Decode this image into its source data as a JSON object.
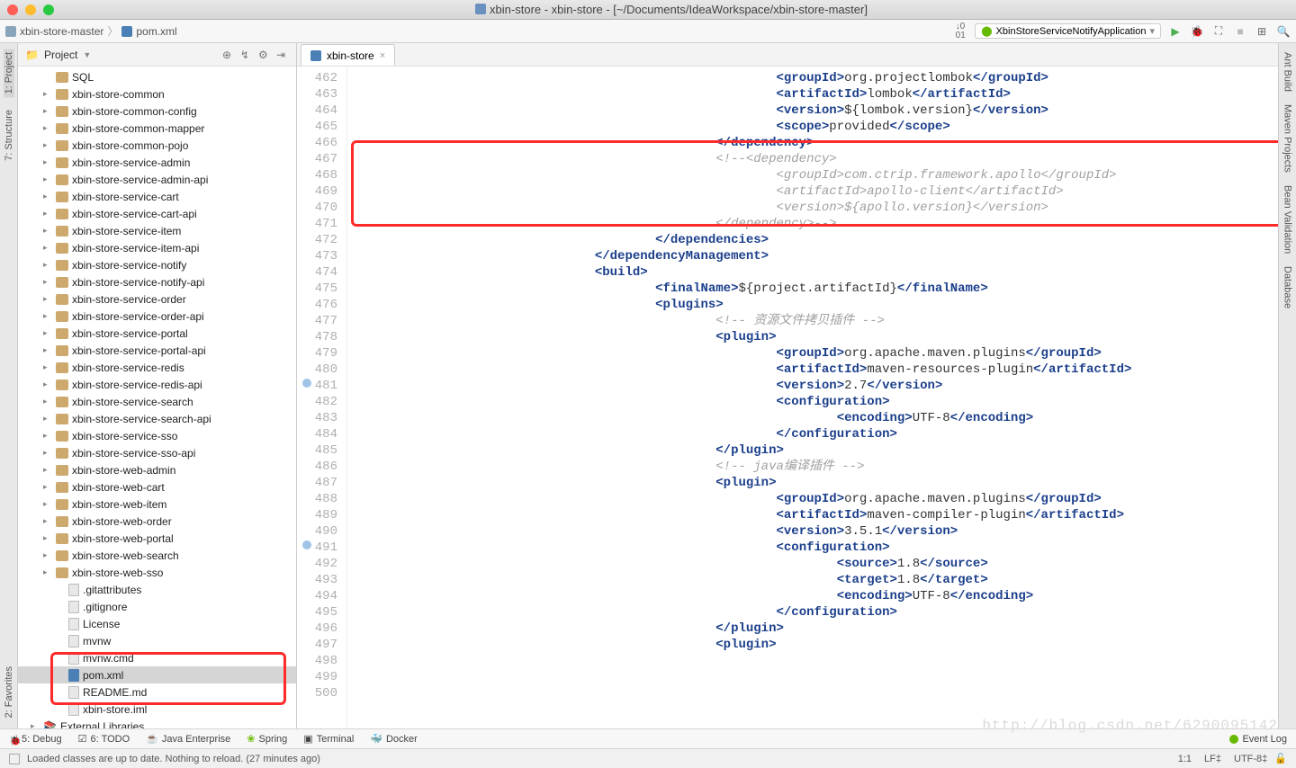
{
  "window": {
    "title": "xbin-store - xbin-store - [~/Documents/IdeaWorkspace/xbin-store-master]"
  },
  "breadcrumb": {
    "root": "xbin-store-master",
    "file": "pom.xml"
  },
  "runconfig": {
    "name": "XbinStoreServiceNotifyApplication"
  },
  "leftTabs": {
    "project": "1: Project",
    "structure": "7: Structure",
    "favorites": "2: Favorites"
  },
  "rightTabs": {
    "ant": "Ant Build",
    "maven": "Maven Projects",
    "bean": "Bean Validation",
    "db": "Database"
  },
  "projectPane": {
    "title": "Project"
  },
  "tree": [
    {
      "label": "SQL",
      "kind": "folder",
      "arrow": false,
      "indent": 28,
      "sql": true
    },
    {
      "label": "xbin-store-common",
      "kind": "folder",
      "arrow": true,
      "indent": 28
    },
    {
      "label": "xbin-store-common-config",
      "kind": "folder",
      "arrow": true,
      "indent": 28
    },
    {
      "label": "xbin-store-common-mapper",
      "kind": "folder",
      "arrow": true,
      "indent": 28
    },
    {
      "label": "xbin-store-common-pojo",
      "kind": "folder",
      "arrow": true,
      "indent": 28
    },
    {
      "label": "xbin-store-service-admin",
      "kind": "folder",
      "arrow": true,
      "indent": 28
    },
    {
      "label": "xbin-store-service-admin-api",
      "kind": "folder",
      "arrow": true,
      "indent": 28
    },
    {
      "label": "xbin-store-service-cart",
      "kind": "folder",
      "arrow": true,
      "indent": 28
    },
    {
      "label": "xbin-store-service-cart-api",
      "kind": "folder",
      "arrow": true,
      "indent": 28
    },
    {
      "label": "xbin-store-service-item",
      "kind": "folder",
      "arrow": true,
      "indent": 28
    },
    {
      "label": "xbin-store-service-item-api",
      "kind": "folder",
      "arrow": true,
      "indent": 28
    },
    {
      "label": "xbin-store-service-notify",
      "kind": "folder",
      "arrow": true,
      "indent": 28
    },
    {
      "label": "xbin-store-service-notify-api",
      "kind": "folder",
      "arrow": true,
      "indent": 28
    },
    {
      "label": "xbin-store-service-order",
      "kind": "folder",
      "arrow": true,
      "indent": 28
    },
    {
      "label": "xbin-store-service-order-api",
      "kind": "folder",
      "arrow": true,
      "indent": 28
    },
    {
      "label": "xbin-store-service-portal",
      "kind": "folder",
      "arrow": true,
      "indent": 28
    },
    {
      "label": "xbin-store-service-portal-api",
      "kind": "folder",
      "arrow": true,
      "indent": 28
    },
    {
      "label": "xbin-store-service-redis",
      "kind": "folder",
      "arrow": true,
      "indent": 28
    },
    {
      "label": "xbin-store-service-redis-api",
      "kind": "folder",
      "arrow": true,
      "indent": 28
    },
    {
      "label": "xbin-store-service-search",
      "kind": "folder",
      "arrow": true,
      "indent": 28
    },
    {
      "label": "xbin-store-service-search-api",
      "kind": "folder",
      "arrow": true,
      "indent": 28
    },
    {
      "label": "xbin-store-service-sso",
      "kind": "folder",
      "arrow": true,
      "indent": 28
    },
    {
      "label": "xbin-store-service-sso-api",
      "kind": "folder",
      "arrow": true,
      "indent": 28
    },
    {
      "label": "xbin-store-web-admin",
      "kind": "folder",
      "arrow": true,
      "indent": 28
    },
    {
      "label": "xbin-store-web-cart",
      "kind": "folder",
      "arrow": true,
      "indent": 28
    },
    {
      "label": "xbin-store-web-item",
      "kind": "folder",
      "arrow": true,
      "indent": 28
    },
    {
      "label": "xbin-store-web-order",
      "kind": "folder",
      "arrow": true,
      "indent": 28
    },
    {
      "label": "xbin-store-web-portal",
      "kind": "folder",
      "arrow": true,
      "indent": 28
    },
    {
      "label": "xbin-store-web-search",
      "kind": "folder",
      "arrow": true,
      "indent": 28
    },
    {
      "label": "xbin-store-web-sso",
      "kind": "folder",
      "arrow": true,
      "indent": 28
    },
    {
      "label": ".gitattributes",
      "kind": "file",
      "arrow": false,
      "indent": 42
    },
    {
      "label": ".gitignore",
      "kind": "file",
      "arrow": false,
      "indent": 42
    },
    {
      "label": "License",
      "kind": "file",
      "arrow": false,
      "indent": 42
    },
    {
      "label": "mvnw",
      "kind": "file",
      "arrow": false,
      "indent": 42
    },
    {
      "label": "mvnw.cmd",
      "kind": "file",
      "arrow": false,
      "indent": 42
    },
    {
      "label": "pom.xml",
      "kind": "mfile",
      "arrow": false,
      "indent": 42,
      "sel": true
    },
    {
      "label": "README.md",
      "kind": "file",
      "arrow": false,
      "indent": 42
    },
    {
      "label": "xbin-store.iml",
      "kind": "file",
      "arrow": false,
      "indent": 42
    },
    {
      "label": "External Libraries",
      "kind": "lib",
      "arrow": true,
      "indent": 14
    }
  ],
  "tab": {
    "name": "xbin-store"
  },
  "gutter": {
    "start": 462,
    "end": 500,
    "compose": [
      481,
      491
    ]
  },
  "code": [
    {
      "indent": 14,
      "parts": [
        {
          "t": "tg",
          "v": "<groupId>"
        },
        {
          "t": "txt",
          "v": "org.projectlombok"
        },
        {
          "t": "tg",
          "v": "</groupId>"
        }
      ]
    },
    {
      "indent": 14,
      "parts": [
        {
          "t": "tg",
          "v": "<artifactId>"
        },
        {
          "t": "txt",
          "v": "lombok"
        },
        {
          "t": "tg",
          "v": "</artifactId>"
        }
      ]
    },
    {
      "indent": 14,
      "parts": [
        {
          "t": "tg",
          "v": "<version>"
        },
        {
          "t": "txt",
          "v": "${lombok.version}"
        },
        {
          "t": "tg",
          "v": "</version>"
        }
      ]
    },
    {
      "indent": 14,
      "parts": [
        {
          "t": "tg",
          "v": "<scope>"
        },
        {
          "t": "txt",
          "v": "provided"
        },
        {
          "t": "tg",
          "v": "</scope>"
        }
      ]
    },
    {
      "indent": 12,
      "parts": [
        {
          "t": "tg",
          "v": "</dependency>"
        }
      ]
    },
    {
      "indent": 12,
      "parts": [
        {
          "t": "cmt",
          "v": "<!--<dependency>"
        }
      ]
    },
    {
      "indent": 14,
      "parts": [
        {
          "t": "cmt",
          "v": "<groupId>com.ctrip.framework.apollo</groupId>"
        }
      ]
    },
    {
      "indent": 14,
      "parts": [
        {
          "t": "cmt",
          "v": "<artifactId>apollo-client</artifactId>"
        }
      ]
    },
    {
      "indent": 14,
      "parts": [
        {
          "t": "cmt",
          "v": "<version>${apollo.version}</version>"
        }
      ]
    },
    {
      "indent": 12,
      "parts": [
        {
          "t": "cmt",
          "v": "</dependency>-->"
        }
      ]
    },
    {
      "indent": 10,
      "parts": [
        {
          "t": "tg",
          "v": "</dependencies>"
        }
      ]
    },
    {
      "indent": 8,
      "parts": [
        {
          "t": "tg",
          "v": "</dependencyManagement>"
        }
      ]
    },
    {
      "indent": 0,
      "parts": [
        {
          "t": "txt",
          "v": ""
        }
      ]
    },
    {
      "indent": 8,
      "parts": [
        {
          "t": "tg",
          "v": "<build>"
        }
      ]
    },
    {
      "indent": 10,
      "parts": [
        {
          "t": "tg",
          "v": "<finalName>"
        },
        {
          "t": "txt",
          "v": "${project.artifactId}"
        },
        {
          "t": "tg",
          "v": "</finalName>"
        }
      ]
    },
    {
      "indent": 10,
      "parts": [
        {
          "t": "tg",
          "v": "<plugins>"
        }
      ]
    },
    {
      "indent": 12,
      "parts": [
        {
          "t": "cmt",
          "v": "<!-- 资源文件拷贝插件 -->"
        }
      ]
    },
    {
      "indent": 12,
      "parts": [
        {
          "t": "tg",
          "v": "<plugin>"
        }
      ]
    },
    {
      "indent": 14,
      "parts": [
        {
          "t": "tg",
          "v": "<groupId>"
        },
        {
          "t": "txt",
          "v": "org.apache.maven.plugins"
        },
        {
          "t": "tg",
          "v": "</groupId>"
        }
      ]
    },
    {
      "indent": 14,
      "parts": [
        {
          "t": "tg",
          "v": "<artifactId>"
        },
        {
          "t": "txt",
          "v": "maven-resources-plugin"
        },
        {
          "t": "tg",
          "v": "</artifactId>"
        }
      ]
    },
    {
      "indent": 14,
      "parts": [
        {
          "t": "tg",
          "v": "<version>"
        },
        {
          "t": "txt",
          "v": "2.7"
        },
        {
          "t": "tg",
          "v": "</version>"
        }
      ]
    },
    {
      "indent": 14,
      "parts": [
        {
          "t": "tg",
          "v": "<configuration>"
        }
      ]
    },
    {
      "indent": 16,
      "parts": [
        {
          "t": "tg",
          "v": "<encoding>"
        },
        {
          "t": "txt",
          "v": "UTF-8"
        },
        {
          "t": "tg",
          "v": "</encoding>"
        }
      ]
    },
    {
      "indent": 0,
      "parts": [
        {
          "t": "txt",
          "v": ""
        }
      ]
    },
    {
      "indent": 14,
      "parts": [
        {
          "t": "tg",
          "v": "</configuration>"
        }
      ]
    },
    {
      "indent": 12,
      "parts": [
        {
          "t": "tg",
          "v": "</plugin>"
        }
      ]
    },
    {
      "indent": 12,
      "parts": [
        {
          "t": "cmt",
          "v": "<!-- java编译插件 -->"
        }
      ]
    },
    {
      "indent": 12,
      "parts": [
        {
          "t": "tg",
          "v": "<plugin>"
        }
      ]
    },
    {
      "indent": 14,
      "parts": [
        {
          "t": "tg",
          "v": "<groupId>"
        },
        {
          "t": "txt",
          "v": "org.apache.maven.plugins"
        },
        {
          "t": "tg",
          "v": "</groupId>"
        }
      ]
    },
    {
      "indent": 14,
      "parts": [
        {
          "t": "tg",
          "v": "<artifactId>"
        },
        {
          "t": "txt",
          "v": "maven-compiler-plugin"
        },
        {
          "t": "tg",
          "v": "</artifactId>"
        }
      ]
    },
    {
      "indent": 14,
      "parts": [
        {
          "t": "tg",
          "v": "<version>"
        },
        {
          "t": "txt",
          "v": "3.5.1"
        },
        {
          "t": "tg",
          "v": "</version>"
        }
      ]
    },
    {
      "indent": 14,
      "parts": [
        {
          "t": "tg",
          "v": "<configuration>"
        }
      ]
    },
    {
      "indent": 16,
      "parts": [
        {
          "t": "tg",
          "v": "<source>"
        },
        {
          "t": "txt",
          "v": "1.8"
        },
        {
          "t": "tg",
          "v": "</source>"
        }
      ]
    },
    {
      "indent": 16,
      "parts": [
        {
          "t": "tg",
          "v": "<target>"
        },
        {
          "t": "txt",
          "v": "1.8"
        },
        {
          "t": "tg",
          "v": "</target>"
        }
      ]
    },
    {
      "indent": 16,
      "parts": [
        {
          "t": "tg",
          "v": "<encoding>"
        },
        {
          "t": "txt",
          "v": "UTF-8"
        },
        {
          "t": "tg",
          "v": "</encoding>"
        }
      ]
    },
    {
      "indent": 14,
      "parts": [
        {
          "t": "tg",
          "v": "</configuration>"
        }
      ]
    },
    {
      "indent": 12,
      "parts": [
        {
          "t": "tg",
          "v": "</plugin>"
        }
      ]
    },
    {
      "indent": 0,
      "parts": [
        {
          "t": "txt",
          "v": ""
        }
      ]
    },
    {
      "indent": 12,
      "parts": [
        {
          "t": "tg",
          "v": "<plugin>"
        }
      ]
    }
  ],
  "tools": {
    "debug": "5: Debug",
    "todo": "6: TODO",
    "java": "Java Enterprise",
    "spring": "Spring",
    "terminal": "Terminal",
    "docker": "Docker",
    "eventlog": "Event Log"
  },
  "status": {
    "msg": "Loaded classes are up to date. Nothing to reload. (27 minutes ago)",
    "pos": "1:1",
    "sep": "LF‡",
    "enc": "UTF-8‡"
  },
  "watermark": "http://blog.csdn.net/6290095142"
}
